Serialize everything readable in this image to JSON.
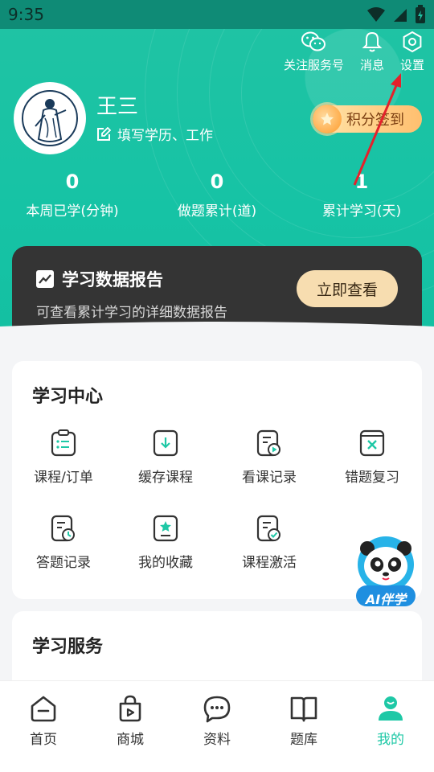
{
  "status_bar": {
    "time": "9:35"
  },
  "header": {
    "wechat_label": "关注服务号",
    "messages_label": "消息",
    "settings_label": "设置",
    "user_name": "王三",
    "edit_profile_label": "填写学历、工作",
    "signin_label": "积分签到"
  },
  "stats": [
    {
      "value": "0",
      "label": "本周已学(分钟)"
    },
    {
      "value": "0",
      "label": "做题累计(道)"
    },
    {
      "value": "1",
      "label": "累计学习(天)"
    }
  ],
  "report": {
    "title": "学习数据报告",
    "subtitle": "可查看累计学习的详细数据报告",
    "button": "立即查看"
  },
  "study_center": {
    "title": "学习中心",
    "items": [
      {
        "label": "课程/订单",
        "icon": "clipboard-list-icon"
      },
      {
        "label": "缓存课程",
        "icon": "download-doc-icon"
      },
      {
        "label": "看课记录",
        "icon": "play-record-icon"
      },
      {
        "label": "错题复习",
        "icon": "wrong-question-icon"
      },
      {
        "label": "答题记录",
        "icon": "answer-record-icon"
      },
      {
        "label": "我的收藏",
        "icon": "star-bookmark-icon"
      },
      {
        "label": "课程激活",
        "icon": "activate-course-icon"
      }
    ]
  },
  "ai_companion": {
    "label": "AI伴学"
  },
  "study_service": {
    "title": "学习服务"
  },
  "tabbar": [
    {
      "label": "首页",
      "icon": "home-icon",
      "active": false
    },
    {
      "label": "商城",
      "icon": "shop-bag-icon",
      "active": false
    },
    {
      "label": "资料",
      "icon": "chat-bubble-icon",
      "active": false
    },
    {
      "label": "题库",
      "icon": "book-icon",
      "active": false
    },
    {
      "label": "我的",
      "icon": "profile-icon",
      "active": true
    }
  ],
  "colors": {
    "accent": "#1ec8a6",
    "report_bg": "#343434",
    "report_button": "#f7ddb0",
    "annotation_arrow": "#e5212b"
  }
}
